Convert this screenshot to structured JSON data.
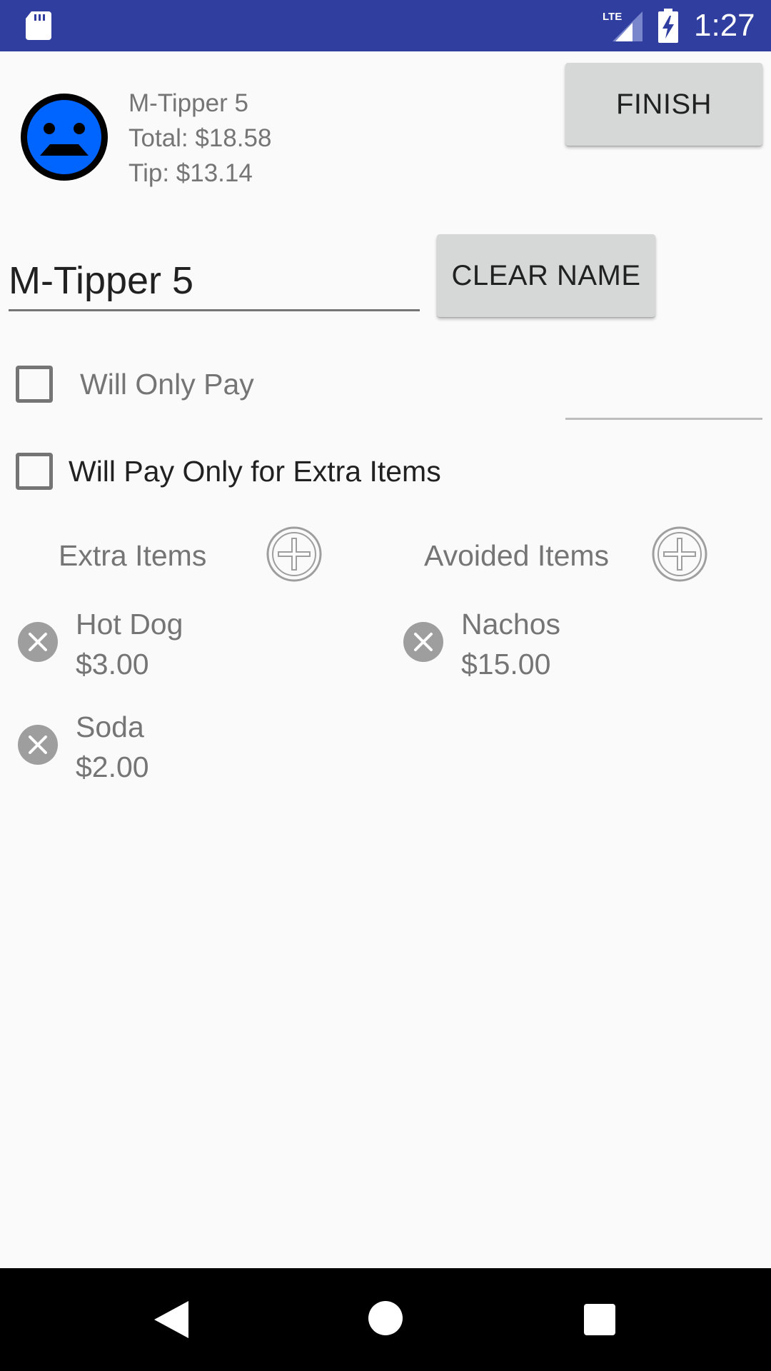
{
  "status_bar": {
    "time": "1:27",
    "network": "LTE",
    "icons": [
      "sd-card-icon",
      "lte-signal-icon",
      "battery-charging-icon"
    ]
  },
  "header": {
    "avatar_icon": "sad-face-icon",
    "avatar_color": "#0064FF",
    "name_line": "M-Tipper 5",
    "total_line": "Total: $18.58",
    "tip_line": "Tip: $13.14",
    "finish_label": "FINISH"
  },
  "name_field": {
    "value": "M-Tipper 5",
    "clear_label": "CLEAR NAME"
  },
  "options": {
    "will_only_pay_label": "Will Only Pay",
    "will_only_pay_checked": false,
    "will_only_pay_amount": "",
    "extra_only_label": "Will Pay Only for Extra Items",
    "extra_only_checked": false
  },
  "extra_items": {
    "title": "Extra Items",
    "items": [
      {
        "name": "Hot Dog",
        "price": "$3.00"
      },
      {
        "name": "Soda",
        "price": "$2.00"
      }
    ]
  },
  "avoided_items": {
    "title": "Avoided Items",
    "items": [
      {
        "name": "Nachos",
        "price": "$15.00"
      }
    ]
  },
  "nav_bar": {
    "icons": [
      "back-icon",
      "home-icon",
      "recents-icon"
    ]
  },
  "colors": {
    "status_bar": "#303F9F",
    "background": "#FAFAFA",
    "button": "#D6D7D7",
    "secondary_text": "#757575"
  }
}
